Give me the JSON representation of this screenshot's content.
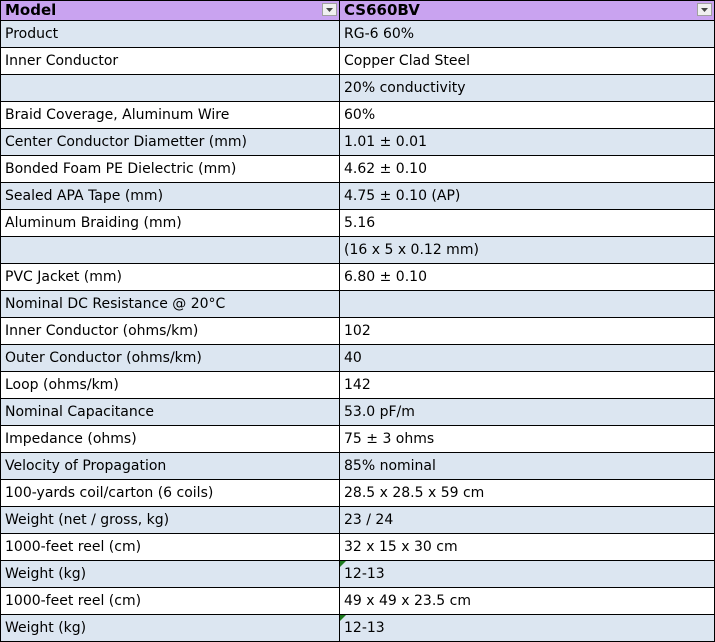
{
  "header": {
    "col1": "Model",
    "col2": "CS660BV",
    "filter_icon": "dropdown-arrow-icon",
    "header_color": "#c9a3f0"
  },
  "colors": {
    "band": "#dce6f1",
    "white": "#ffffff",
    "grid": "#000000",
    "error_indicator": "#1e7a1e"
  },
  "rows": [
    {
      "label": "Product",
      "value": "RG-6 60%"
    },
    {
      "label": "Inner Conductor",
      "value": "Copper Clad Steel"
    },
    {
      "label": "",
      "value": "20% conductivity"
    },
    {
      "label": "Braid Coverage, Aluminum Wire",
      "value": "60%"
    },
    {
      "label": "Center Conductor Diametter (mm)",
      "value": "1.01 ± 0.01"
    },
    {
      "label": "Bonded Foam PE Dielectric (mm)",
      "value": "4.62 ± 0.10"
    },
    {
      "label": "Sealed APA Tape (mm)",
      "value": "4.75 ± 0.10 (AP)"
    },
    {
      "label": "Aluminum Braiding (mm)",
      "value": "5.16"
    },
    {
      "label": "",
      "value": "(16 x 5 x 0.12 mm)"
    },
    {
      "label": "PVC Jacket (mm)",
      "value": "6.80 ± 0.10"
    },
    {
      "label": "Nominal DC Resistance @ 20°C",
      "value": ""
    },
    {
      "label": "Inner Conductor (ohms/km)",
      "value": "102"
    },
    {
      "label": "Outer Conductor (ohms/km)",
      "value": "40"
    },
    {
      "label": "Loop (ohms/km)",
      "value": "142"
    },
    {
      "label": "Nominal Capacitance",
      "value": "53.0 pF/m"
    },
    {
      "label": "Impedance (ohms)",
      "value": "75 ± 3 ohms"
    },
    {
      "label": "Velocity of  Propagation",
      "value": "85% nominal"
    },
    {
      "label": "100-yards coil/carton (6 coils)",
      "value": "28.5 x 28.5 x 59 cm"
    },
    {
      "label": "Weight (net / gross, kg)",
      "value": "23 / 24"
    },
    {
      "label": "1000-feet reel (cm)",
      "value": "32 x 15 x 30 cm"
    },
    {
      "label": "Weight (kg)",
      "value": "12-13"
    },
    {
      "label": "1000-feet reel (cm)",
      "value": "49 x 49 x 23.5 cm"
    },
    {
      "label": "Weight (kg)",
      "value": "12-13"
    }
  ]
}
